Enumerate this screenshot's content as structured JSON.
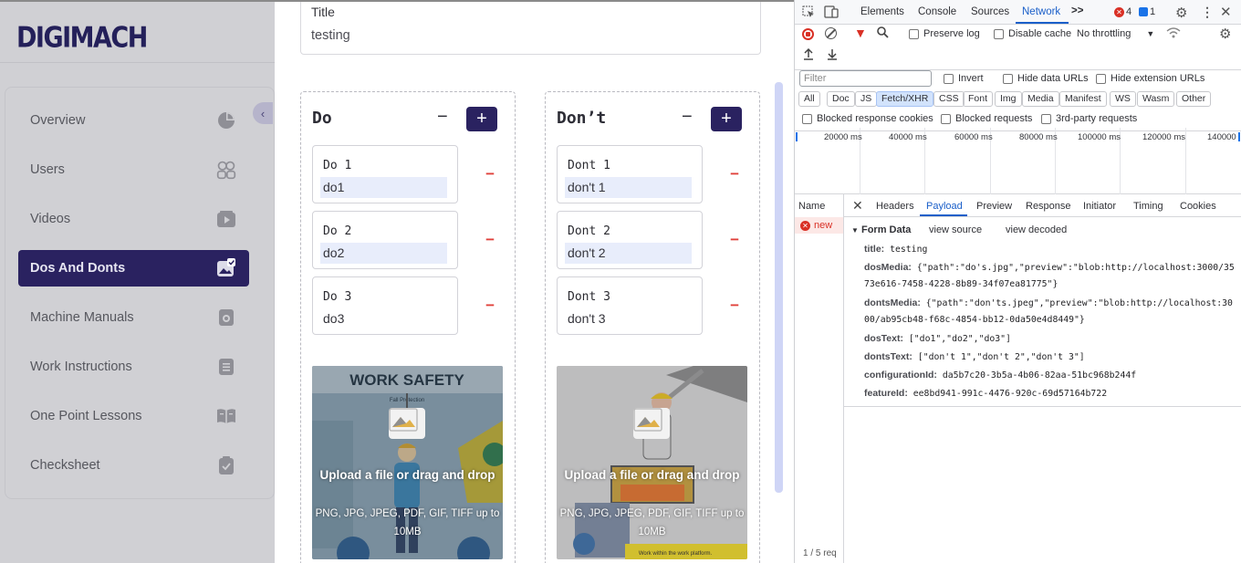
{
  "app": {
    "logo": "DIGIMACH",
    "colors": {
      "brand": "#2a2260",
      "danger": "#e0403a",
      "devtools_accent": "#1a5fc9"
    }
  },
  "sidebar": {
    "collapse_icon": "chevron-left-icon",
    "items": [
      {
        "label": "Overview",
        "icon": "pie-chart-icon",
        "active": false
      },
      {
        "label": "Users",
        "icon": "users-icon",
        "active": false
      },
      {
        "label": "Videos",
        "icon": "video-icon",
        "active": false
      },
      {
        "label": "Dos And Donts",
        "icon": "image-check-icon",
        "active": true
      },
      {
        "label": "Machine Manuals",
        "icon": "manual-icon",
        "active": false
      },
      {
        "label": "Work Instructions",
        "icon": "document-icon",
        "active": false
      },
      {
        "label": "One Point Lessons",
        "icon": "book-icon",
        "active": false
      },
      {
        "label": "Checksheet",
        "icon": "clipboard-check-icon",
        "active": false
      }
    ]
  },
  "main": {
    "title_field": {
      "label": "Title",
      "value": "testing"
    },
    "do_panel": {
      "heading": "Do",
      "minus": "−",
      "plus": "+",
      "entries": [
        {
          "label": "Do 1",
          "value": "do1",
          "highlighted": true
        },
        {
          "label": "Do 2",
          "value": "do2",
          "highlighted": true
        },
        {
          "label": "Do 3",
          "value": "do3",
          "highlighted": false
        }
      ],
      "upload": {
        "link": "Upload a file",
        "rest": "or drag and drop",
        "note": "PNG, JPG, JPEG, PDF, GIF, TIFF up to 10MB",
        "poster_title": "WORK SAFETY",
        "poster_sub": "Fall Protection"
      }
    },
    "dont_panel": {
      "heading": "Don’t",
      "minus": "−",
      "plus": "+",
      "entries": [
        {
          "label": "Dont 1",
          "value": "don't 1",
          "highlighted": true
        },
        {
          "label": "Dont 2",
          "value": "don't 2",
          "highlighted": true
        },
        {
          "label": "Dont 3",
          "value": "don't 3",
          "highlighted": false
        }
      ],
      "upload": {
        "link": "Upload a file",
        "rest": "or drag and drop",
        "note": "PNG, JPG, JPEG, PDF, GIF, TIFF up to 10MB",
        "poster_footer": "Work within the work platform."
      }
    },
    "entry_remove": "−"
  },
  "devtools": {
    "tabs": [
      "Elements",
      "Console",
      "Sources",
      "Network"
    ],
    "active_tab": "Network",
    "more": ">>",
    "errors": "4",
    "messages": "1",
    "toolbar": {
      "preserve_log": "Preserve log",
      "disable_cache": "Disable cache",
      "throttling": "No throttling"
    },
    "filter": {
      "placeholder": "Filter",
      "invert": "Invert",
      "hide_data_urls": "Hide data URLs",
      "hide_extension_urls": "Hide extension URLs",
      "types": [
        "All",
        "Doc",
        "JS",
        "Fetch/XHR",
        "CSS",
        "Font",
        "Img",
        "Media",
        "Manifest",
        "WS",
        "Wasm",
        "Other"
      ],
      "active_type": "Fetch/XHR",
      "blocked_cookies": "Blocked response cookies",
      "blocked_requests": "Blocked requests",
      "third_party": "3rd-party requests"
    },
    "timeline_labels": [
      "20000 ms",
      "40000 ms",
      "60000 ms",
      "80000 ms",
      "100000 ms",
      "120000 ms",
      "140000"
    ],
    "requests": {
      "header": "Name",
      "items": [
        {
          "name": "new",
          "status": "error"
        }
      ],
      "footer": "1 / 5 req"
    },
    "detail_tabs": [
      "Headers",
      "Payload",
      "Preview",
      "Response",
      "Initiator",
      "Timing",
      "Cookies"
    ],
    "active_detail_tab": "Payload",
    "payload": {
      "section": "Form Data",
      "view_source": "view source",
      "view_decoded": "view decoded",
      "rows": [
        {
          "key": "title:",
          "lines": [
            "testing"
          ]
        },
        {
          "key": "dosMedia:",
          "lines": [
            "{\"path\":\"do's.jpg\",\"preview\":\"blob:http://localhost:3000/35",
            "73e616-7458-4228-8b89-34f07ea81775\"}"
          ]
        },
        {
          "key": "dontsMedia:",
          "lines": [
            "{\"path\":\"don'ts.jpeg\",\"preview\":\"blob:http://localhost:30",
            "00/ab95cb48-f68c-4854-bb12-0da50e4d8449\"}"
          ]
        },
        {
          "key": "dosText:",
          "lines": [
            "[\"do1\",\"do2\",\"do3\"]"
          ]
        },
        {
          "key": "dontsText:",
          "lines": [
            "[\"don't 1\",\"don't 2\",\"don't 3\"]"
          ]
        },
        {
          "key": "configurationId:",
          "lines": [
            "da5b7c20-3b5a-4b06-82aa-51bc968b244f"
          ]
        },
        {
          "key": "featureId:",
          "lines": [
            "ee8bd941-991c-4476-920c-69d57164b722"
          ]
        }
      ]
    }
  }
}
